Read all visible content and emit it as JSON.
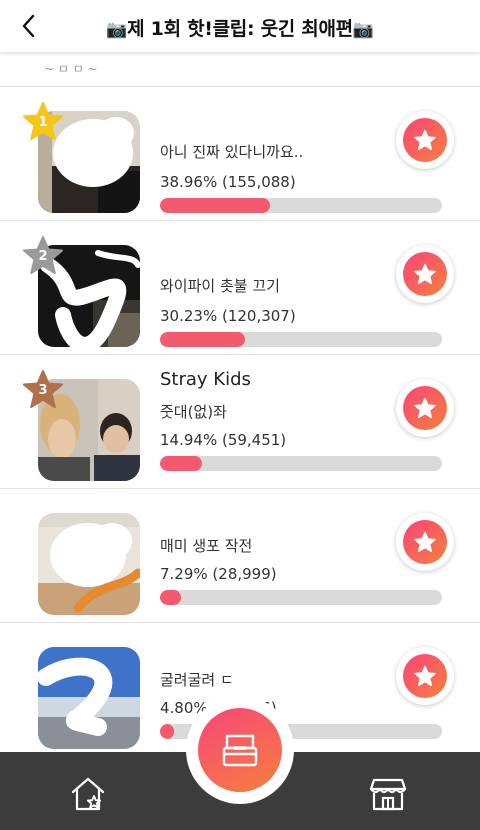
{
  "header": {
    "back_icon": "chevron-left-icon",
    "title_prefix_icon": "📷",
    "title": "제 1회 핫!클립: 웃긴 최애편",
    "title_suffix_icon": "📷"
  },
  "subtext": "~ ㅁ ㅁ ~",
  "items": [
    {
      "rank": "1",
      "badge_color": "#f5c518",
      "artist": "",
      "song": "아니 진짜 있다니까요..",
      "stat": "38.96% (155,088)",
      "share": 0.3896
    },
    {
      "rank": "2",
      "badge_color": "#9a9a9a",
      "artist": "",
      "song": "와이파이 촛불 끄기",
      "stat": "30.23% (120,307)",
      "share": 0.3023
    },
    {
      "rank": "3",
      "badge_color": "#b0704a",
      "artist": "Stray Kids",
      "song": "줏대(없)좌",
      "stat": "14.94% (59,451)",
      "share": 0.1494
    },
    {
      "rank": "",
      "badge_color": "",
      "artist": "",
      "song": "매미 생포 작전",
      "stat": "7.29% (28,999)",
      "share": 0.0729
    },
    {
      "rank": "",
      "badge_color": "",
      "artist": "",
      "song": "굴려굴려 ㄷ",
      "stat": "4.80% (19,086)",
      "share": 0.048
    }
  ],
  "colors": {
    "accent_start": "#f8457a",
    "accent_end": "#f6803c",
    "bar_fill": "#f35a6d",
    "bar_track": "#dadada",
    "nav_background": "#3c3c3c"
  },
  "nav": {
    "home_icon": "home-star-icon",
    "center_icon": "ballot-box-icon",
    "store_icon": "store-icon"
  }
}
